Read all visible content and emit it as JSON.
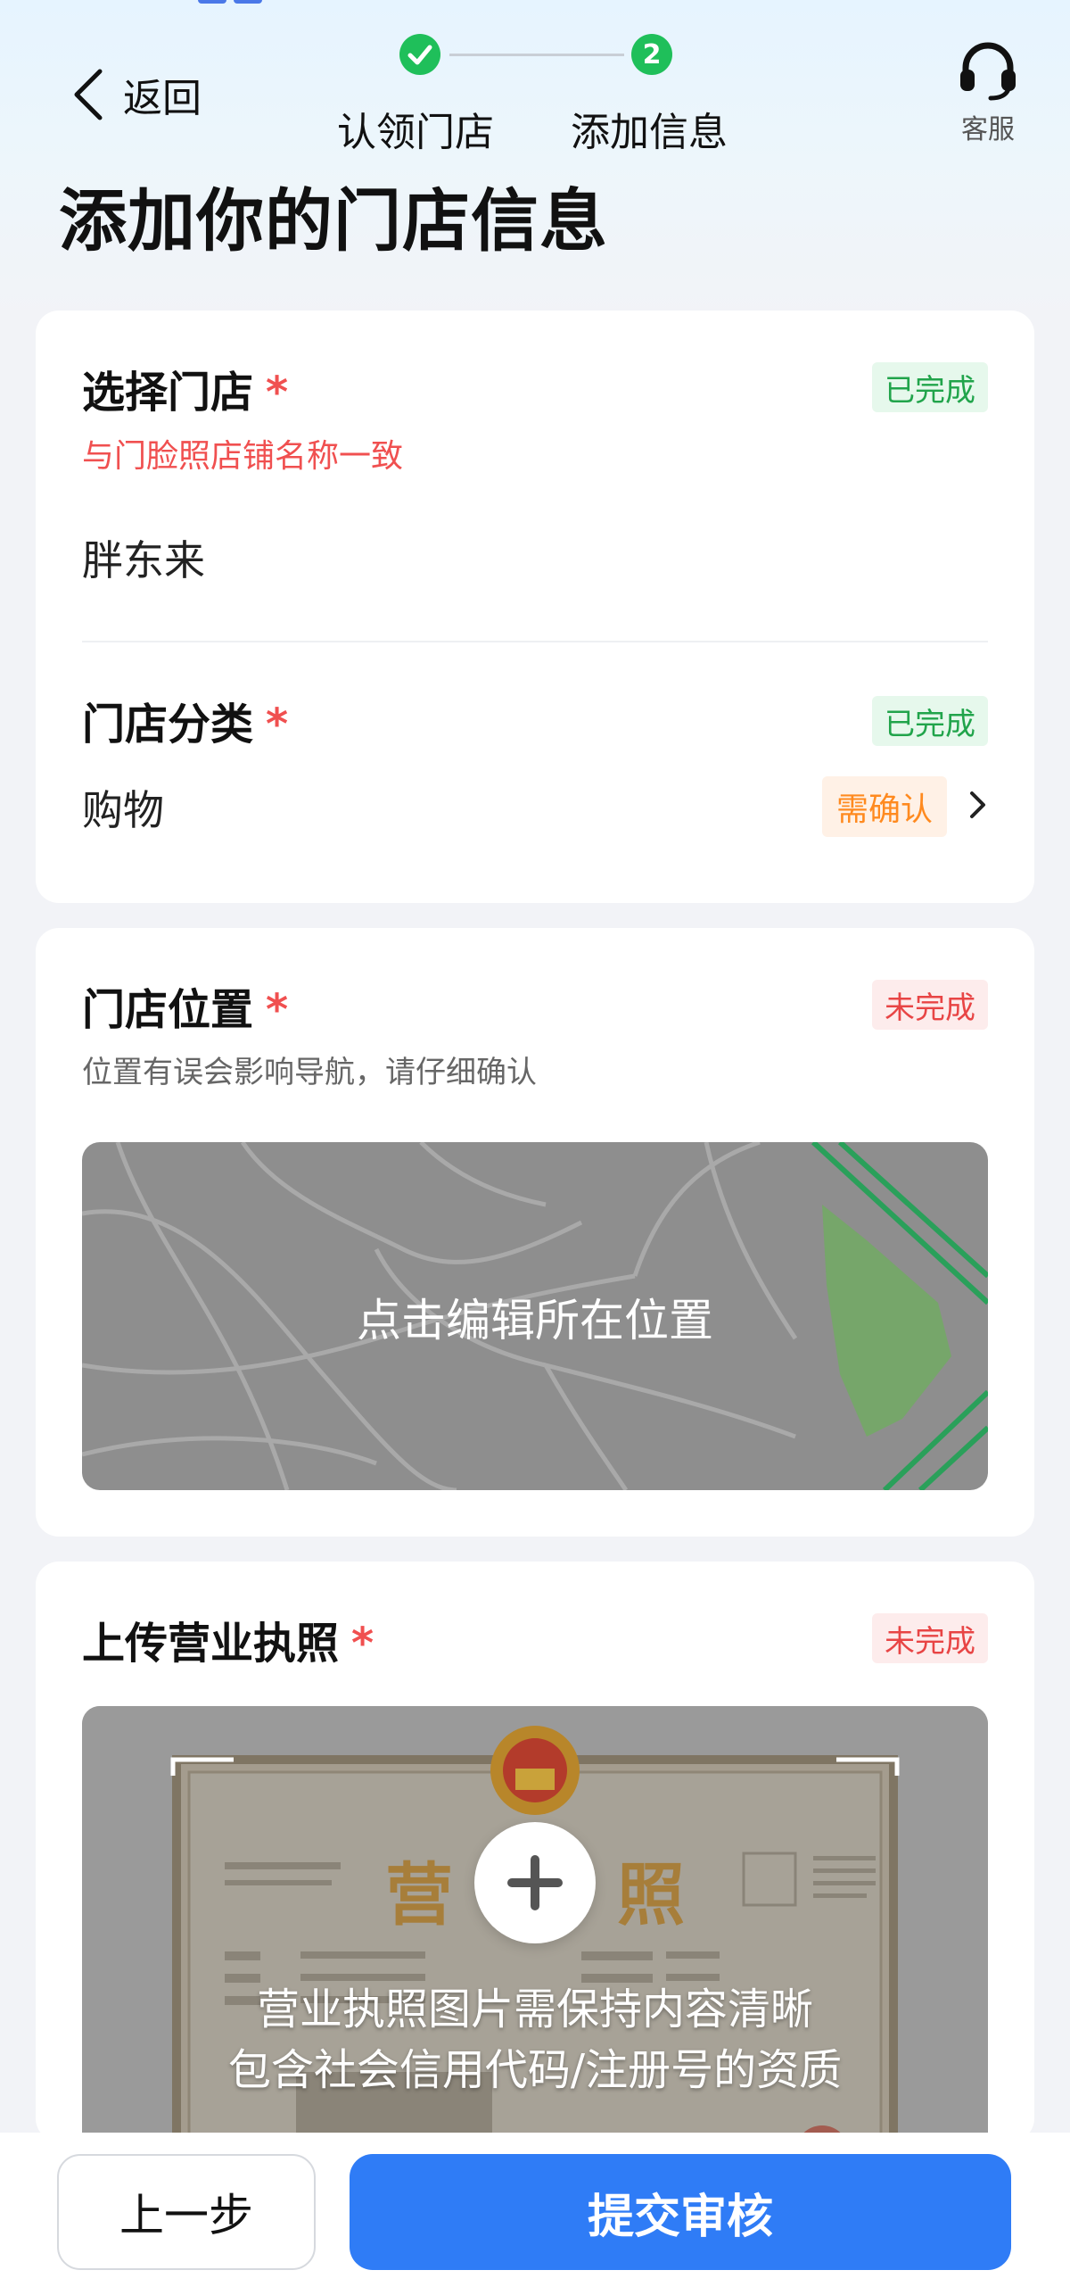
{
  "header": {
    "back_label": "返回",
    "steps": [
      {
        "number": "1",
        "label": "认领门店",
        "state": "done"
      },
      {
        "number": "2",
        "label": "添加信息",
        "state": "current"
      }
    ],
    "service_label": "客服"
  },
  "page_title": "添加你的门店信息",
  "store_select": {
    "title": "选择门店",
    "required_mark": "*",
    "status": "已完成",
    "hint": "与门脸照店铺名称一致",
    "value": "胖东来"
  },
  "store_category": {
    "title": "门店分类",
    "required_mark": "*",
    "status": "已完成",
    "value": "购物",
    "confirm_tag": "需确认"
  },
  "store_location": {
    "title": "门店位置",
    "required_mark": "*",
    "status": "未完成",
    "hint": "位置有误会影响导航，请仔细确认",
    "map_action": "点击编辑所在位置"
  },
  "business_license": {
    "title": "上传营业执照",
    "required_mark": "*",
    "status": "未完成",
    "sample_title_left": "营",
    "sample_title_right": "照",
    "note_line1": "营业执照图片需保持内容清晰",
    "note_line2": "包含社会信用代码/注册号的资质"
  },
  "footer": {
    "prev_label": "上一步",
    "submit_label": "提交审核"
  },
  "colors": {
    "primary": "#2f7cf6",
    "success": "#1fbf5a",
    "danger": "#f05050",
    "warning": "#ff8a1f"
  }
}
